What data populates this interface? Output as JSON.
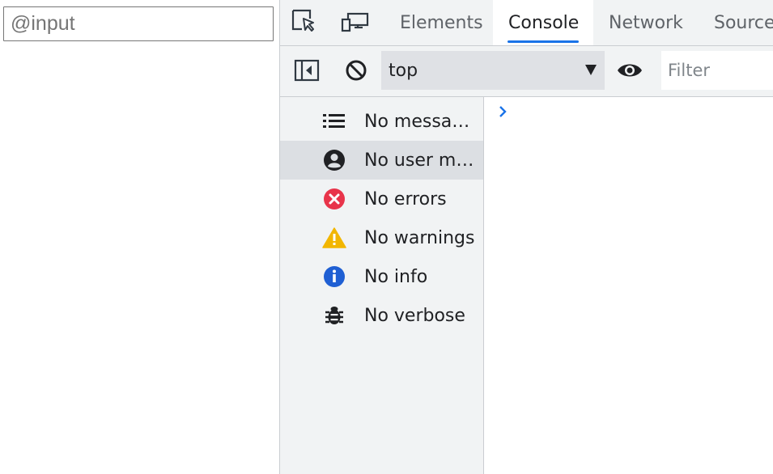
{
  "page": {
    "input_placeholder": "@input",
    "input_value": ""
  },
  "devtools": {
    "toolbar_icons": [
      "inspect-element-icon",
      "device-toolbar-icon"
    ],
    "tabs": [
      {
        "label": "Elements",
        "active": false
      },
      {
        "label": "Console",
        "active": true
      },
      {
        "label": "Network",
        "active": false
      },
      {
        "label": "Sources",
        "active": false
      }
    ],
    "console_toolbar": {
      "context": "top",
      "filter_placeholder": "Filter",
      "icons": [
        "show-sidebar-icon",
        "clear-console-icon",
        "live-expression-eye-icon"
      ]
    },
    "sidebar": {
      "items": [
        {
          "label": "No messages",
          "icon": "list-icon",
          "selected": false
        },
        {
          "label": "No user messages",
          "icon": "user-icon",
          "selected": true
        },
        {
          "label": "No errors",
          "icon": "error-icon",
          "selected": false
        },
        {
          "label": "No warnings",
          "icon": "warning-icon",
          "selected": false
        },
        {
          "label": "No info",
          "icon": "info-icon",
          "selected": false
        },
        {
          "label": "No verbose",
          "icon": "bug-icon",
          "selected": false
        }
      ]
    },
    "colors": {
      "accent": "#1a73e8",
      "error": "#e8344a",
      "warning": "#f2b600",
      "info": "#1f5fd3"
    }
  }
}
